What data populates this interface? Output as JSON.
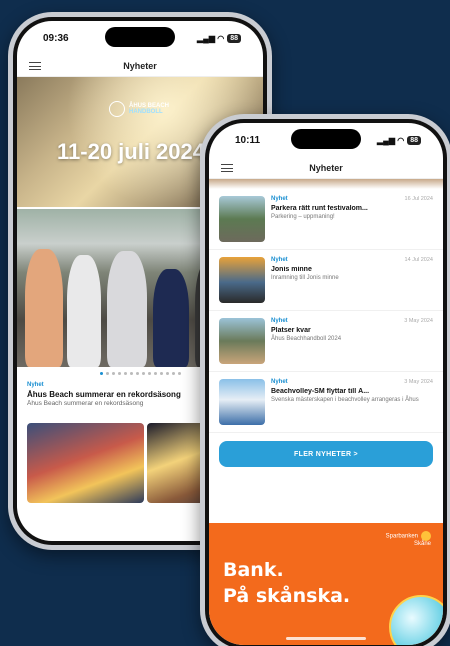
{
  "phone_left": {
    "status": {
      "time": "09:36",
      "battery": "88"
    },
    "nav_title": "Nyheter",
    "hero": {
      "logo_line1": "ÅHUS BEACH",
      "logo_line2": "HANDBOLL",
      "date": "11-20 juli 2024"
    },
    "carousel": {
      "count": 14,
      "active_index": 0
    },
    "news": {
      "tag": "Nyhet",
      "title": "Åhus Beach summerar en rekordsäsong",
      "subtitle": "Åhus Beach summerar en rekordsäsong"
    }
  },
  "phone_right": {
    "status": {
      "time": "10:11",
      "battery": "88"
    },
    "nav_title": "Nyheter",
    "list": [
      {
        "tag": "Nyhet",
        "date": "16 Jul 2024",
        "title": "Parkera rätt runt festivalom...",
        "subtitle": "Parkering – uppmaning!"
      },
      {
        "tag": "Nyhet",
        "date": "14 Jul 2024",
        "title": "Jonis minne",
        "subtitle": "Inramning till Jonis minne"
      },
      {
        "tag": "Nyhet",
        "date": "3 May 2024",
        "title": "Platser kvar",
        "subtitle": "Åhus Beachhandboll 2024"
      },
      {
        "tag": "Nyhet",
        "date": "3 May 2024",
        "title": "Beachvolley-SM flyttar till Å...",
        "subtitle": "Svenska mästerskapen i beachvolley arrangeras i Åhus"
      }
    ],
    "more_button": "FLER NYHETER  >",
    "ad": {
      "line1": "Bank.",
      "line2": "På skånska.",
      "brand_line1": "Sparbanken",
      "brand_line2": "Skåne"
    }
  },
  "colors": {
    "background": "#0f2d4d",
    "accent": "#1a8fd1",
    "ad_orange": "#f36a1c"
  }
}
